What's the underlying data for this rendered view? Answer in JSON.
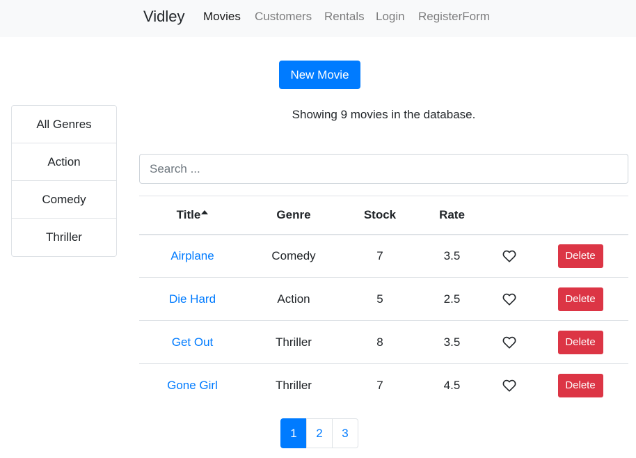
{
  "nav": {
    "brand": "Vidley",
    "links": [
      "Movies",
      "Customers",
      "Rentals",
      "Login",
      "RegisterForm"
    ],
    "active": "Movies"
  },
  "actions": {
    "new_movie": "New Movie"
  },
  "genres": [
    "All Genres",
    "Action",
    "Comedy",
    "Thriller"
  ],
  "status": {
    "showing": "Showing 9 movies in the database."
  },
  "search": {
    "placeholder": "Search ..."
  },
  "table": {
    "columns": [
      "Title",
      "Genre",
      "Stock",
      "Rate"
    ],
    "sorted_by": "Title",
    "sort_direction": "asc",
    "rows": [
      {
        "title": "Airplane",
        "genre": "Comedy",
        "stock": "7",
        "rate": "3.5",
        "liked": false,
        "action": "Delete"
      },
      {
        "title": "Die Hard",
        "genre": "Action",
        "stock": "5",
        "rate": "2.5",
        "liked": false,
        "action": "Delete"
      },
      {
        "title": "Get Out",
        "genre": "Thriller",
        "stock": "8",
        "rate": "3.5",
        "liked": false,
        "action": "Delete"
      },
      {
        "title": "Gone Girl",
        "genre": "Thriller",
        "stock": "7",
        "rate": "4.5",
        "liked": false,
        "action": "Delete"
      }
    ]
  },
  "pagination": {
    "pages": [
      "1",
      "2",
      "3"
    ],
    "current": "1"
  },
  "colors": {
    "primary": "#007bff",
    "danger": "#dc3545",
    "navbar_bg": "#f8f9fa"
  }
}
